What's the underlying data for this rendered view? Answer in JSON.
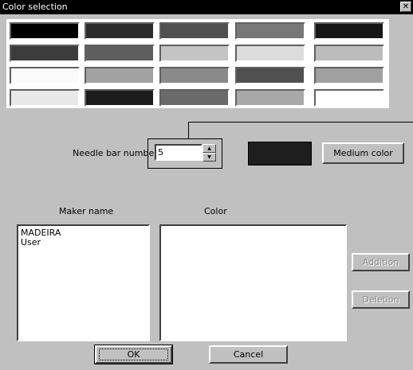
{
  "window": {
    "title": "Color selection",
    "close_glyph": "✕"
  },
  "palette": {
    "rows": [
      [
        "#000000",
        "#2c2c2c",
        "#505050",
        "#787878",
        "#161616"
      ],
      [
        "#3c3c3c",
        "#5e5e5e",
        "#c4c4c4",
        "#dcdcdc",
        "#bcbcbc"
      ],
      [
        "#fafafa",
        "#a2a2a2",
        "#8a8a8a",
        "#505050",
        "#a0a0a0"
      ],
      [
        "#e8e8e8",
        "#1c1c1c",
        "#6a6a6a",
        "#a8a8a8",
        "#ffffff"
      ]
    ]
  },
  "needle": {
    "label": "Needle bar number",
    "value": "5",
    "up_glyph": "▲",
    "down_glyph": "▼"
  },
  "selected_color": "#1e1e1e",
  "medium_color_label": "Medium color",
  "maker": {
    "label": "Maker name",
    "items": [
      "MADEIRA",
      "User"
    ]
  },
  "color_list": {
    "label": "Color",
    "items": []
  },
  "buttons": {
    "addition": "Addition",
    "deletion": "Deletion",
    "ok": "OK",
    "cancel": "Cancel"
  }
}
